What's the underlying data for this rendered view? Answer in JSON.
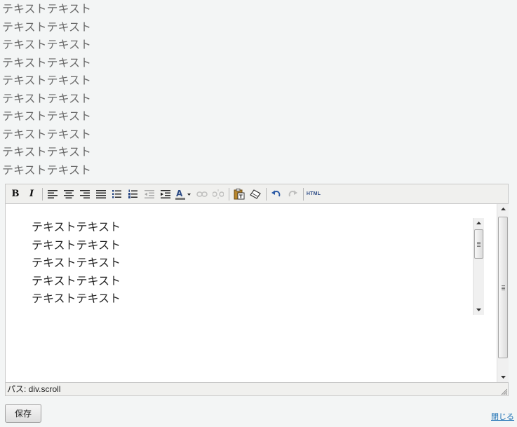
{
  "top_lines": [
    "テキストテキスト",
    "テキストテキスト",
    "テキストテキスト",
    "テキストテキスト",
    "テキストテキスト",
    "テキストテキスト",
    "テキストテキスト",
    "テキストテキスト",
    "テキストテキスト",
    "テキストテキスト"
  ],
  "toolbar": {
    "bold_label": "B",
    "italic_label": "I",
    "html_label": "HTML",
    "icons": [
      "bold-icon",
      "italic-icon",
      "align-left-icon",
      "align-center-icon",
      "align-right-icon",
      "align-justify-icon",
      "bullet-list-icon",
      "numbered-list-icon",
      "outdent-icon",
      "indent-icon",
      "text-color-icon",
      "link-icon",
      "unlink-icon",
      "paste-text-icon",
      "eraser-icon",
      "undo-icon",
      "redo-icon",
      "html-source-icon"
    ]
  },
  "editor": {
    "content_lines": [
      "テキストテキスト",
      "テキストテキスト",
      "テキストテキスト",
      "テキストテキスト",
      "テキストテキスト"
    ]
  },
  "statusbar": {
    "path_text": "パス: div.scroll"
  },
  "footer": {
    "save_label": "保存",
    "close_label": "閉じる"
  },
  "colors": {
    "page_bg": "#f3f5f5",
    "link": "#1a6fb4",
    "text_color_underline": "#7a7a7a"
  }
}
